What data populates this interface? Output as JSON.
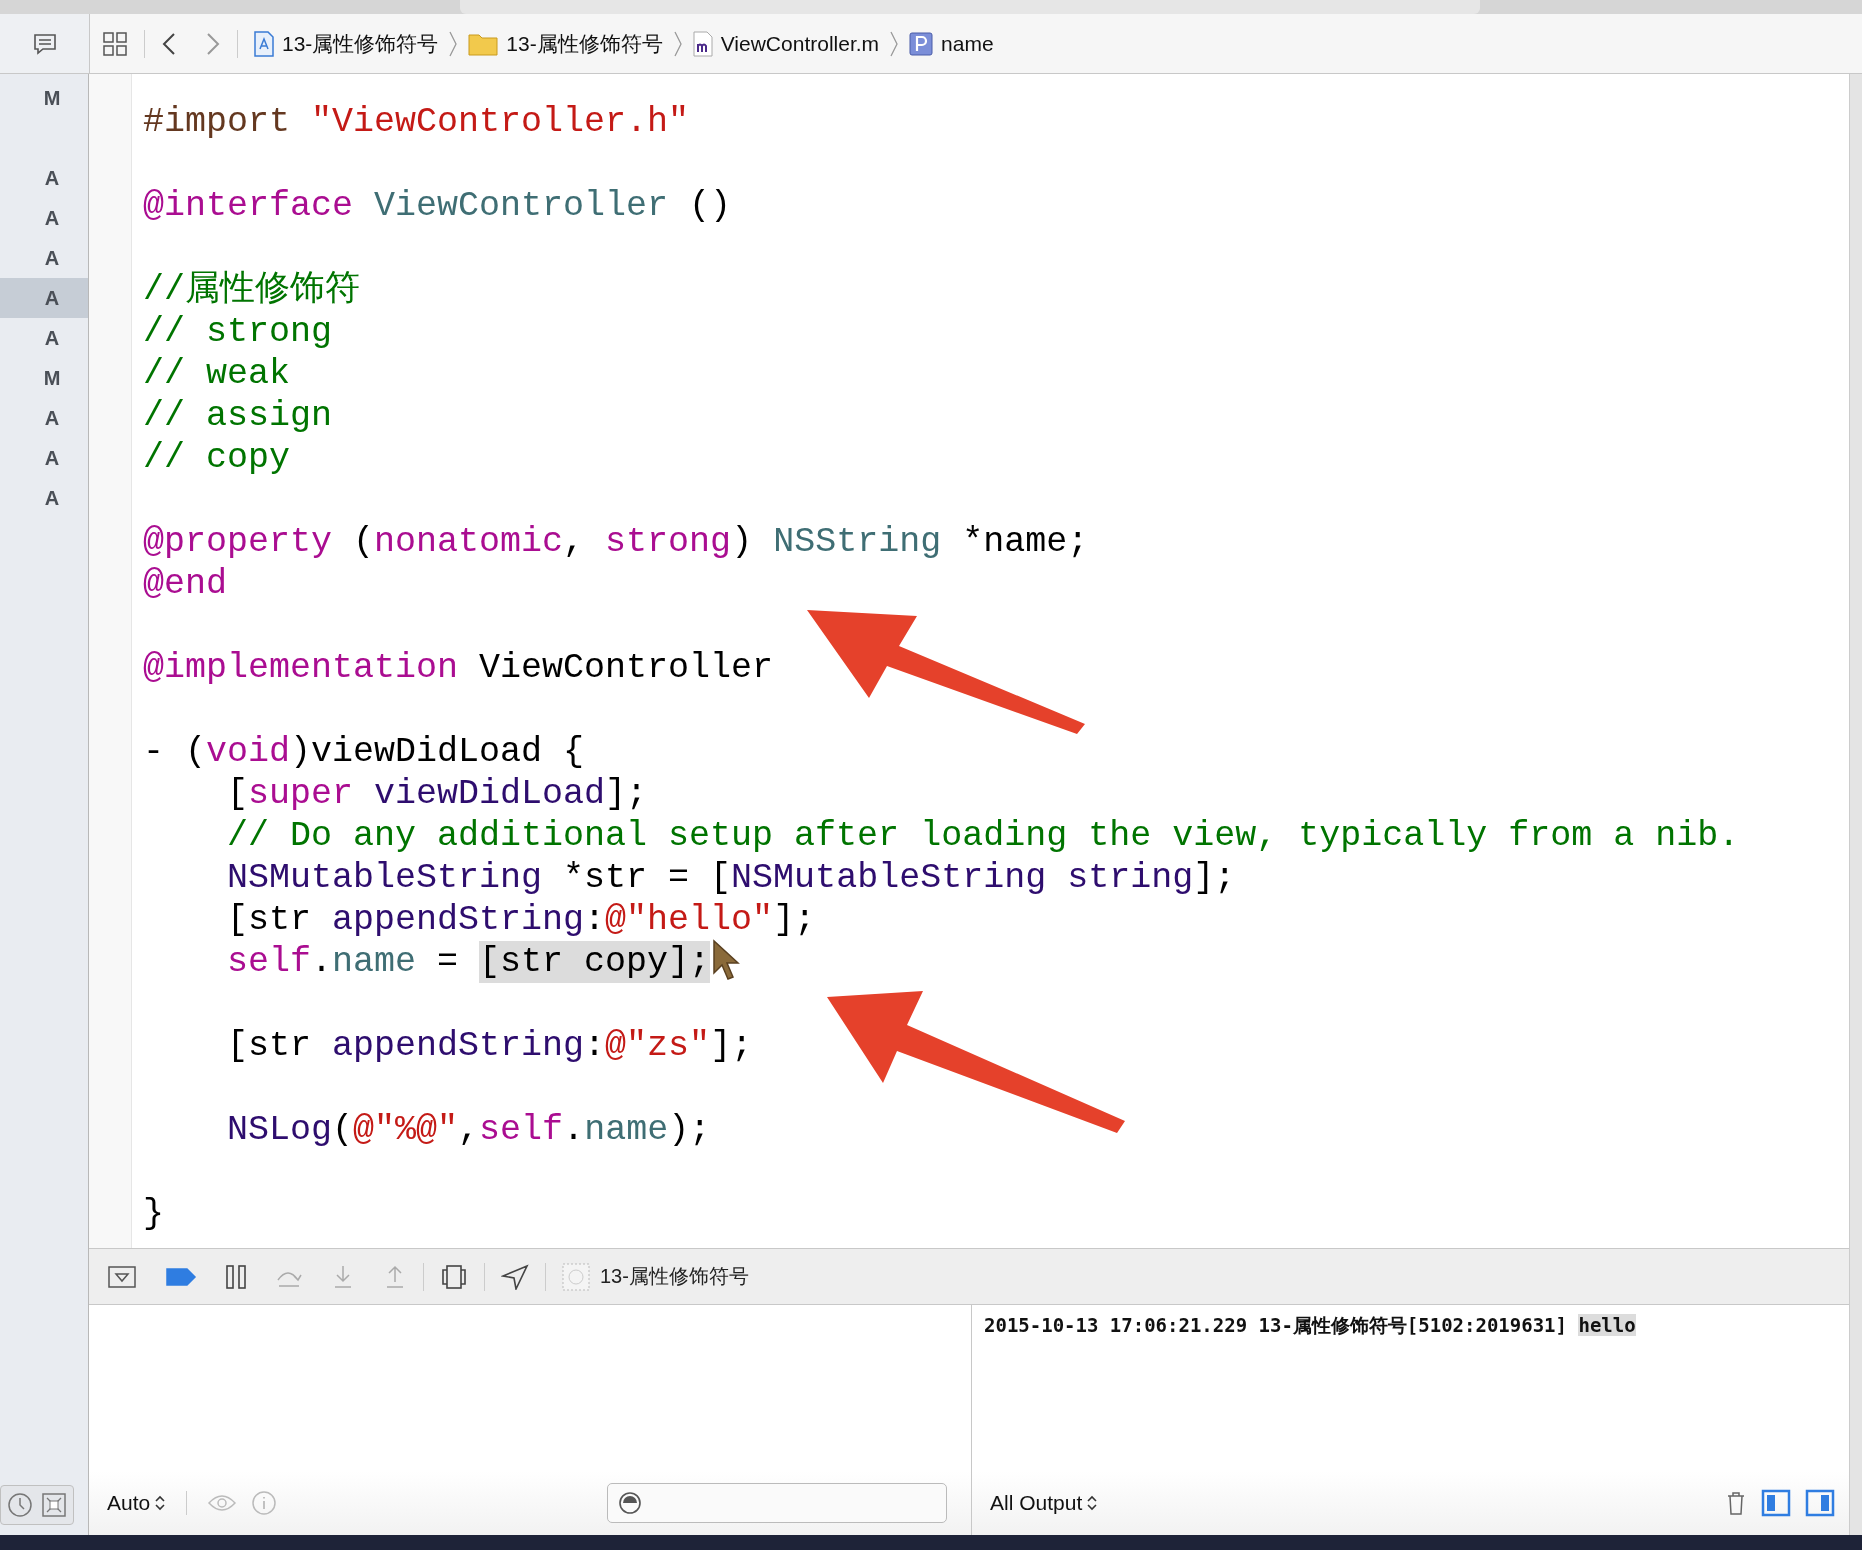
{
  "breadcrumb": [
    {
      "kind": "project",
      "label": "13-属性修饰符号"
    },
    {
      "kind": "folder",
      "label": "13-属性修饰符号"
    },
    {
      "kind": "mfile",
      "label": "ViewController.m"
    },
    {
      "kind": "property",
      "label": "name"
    }
  ],
  "status_letters": [
    {
      "letter": "M",
      "selected": false,
      "space_before": false
    },
    {
      "letter": "A",
      "selected": false,
      "space_before": true
    },
    {
      "letter": "A",
      "selected": false,
      "space_before": false
    },
    {
      "letter": "A",
      "selected": false,
      "space_before": false
    },
    {
      "letter": "A",
      "selected": true,
      "space_before": false
    },
    {
      "letter": "A",
      "selected": false,
      "space_before": false
    },
    {
      "letter": "M",
      "selected": false,
      "space_before": false
    },
    {
      "letter": "A",
      "selected": false,
      "space_before": false
    },
    {
      "letter": "A",
      "selected": false,
      "space_before": false
    },
    {
      "letter": "A",
      "selected": false,
      "space_before": false
    }
  ],
  "code_lines": [
    {
      "space_before": false,
      "tokens": [
        {
          "kind": "preproc",
          "text": "#import "
        },
        {
          "kind": "string",
          "text": "\"ViewController.h\""
        }
      ]
    },
    {
      "space_before": true,
      "tokens": [
        {
          "kind": "keyword",
          "text": "@interface"
        },
        {
          "kind": "class",
          "text": " ViewController"
        },
        {
          "kind": "plain",
          "text": " ()"
        }
      ]
    },
    {
      "space_before": true,
      "tokens": [
        {
          "kind": "comment",
          "text": "//属性修饰符"
        }
      ]
    },
    {
      "space_before": false,
      "tokens": [
        {
          "kind": "comment",
          "text": "// strong"
        }
      ]
    },
    {
      "space_before": false,
      "tokens": [
        {
          "kind": "comment",
          "text": "// weak"
        }
      ]
    },
    {
      "space_before": false,
      "tokens": [
        {
          "kind": "comment",
          "text": "// assign"
        }
      ]
    },
    {
      "space_before": false,
      "tokens": [
        {
          "kind": "comment",
          "text": "// copy"
        }
      ]
    },
    {
      "space_before": true,
      "tokens": [
        {
          "kind": "keyword",
          "text": "@property"
        },
        {
          "kind": "plain",
          "text": " ("
        },
        {
          "kind": "keyword",
          "text": "nonatomic"
        },
        {
          "kind": "plain",
          "text": ", "
        },
        {
          "kind": "keyword",
          "text": "strong"
        },
        {
          "kind": "plain",
          "text": ") "
        },
        {
          "kind": "class",
          "text": "NSString"
        },
        {
          "kind": "plain",
          "text": " *name;"
        }
      ]
    },
    {
      "space_before": false,
      "tokens": [
        {
          "kind": "keyword",
          "text": "@end"
        }
      ]
    },
    {
      "space_before": true,
      "tokens": [
        {
          "kind": "keyword",
          "text": "@implementation"
        },
        {
          "kind": "plain",
          "text": " ViewController"
        }
      ]
    },
    {
      "space_before": true,
      "tokens": [
        {
          "kind": "plain",
          "text": "- ("
        },
        {
          "kind": "keyword",
          "text": "void"
        },
        {
          "kind": "plain",
          "text": ")viewDidLoad {"
        }
      ]
    },
    {
      "space_before": false,
      "tokens": [
        {
          "kind": "plain",
          "text": "    ["
        },
        {
          "kind": "keyword",
          "text": "super"
        },
        {
          "kind": "method",
          "text": " viewDidLoad"
        },
        {
          "kind": "plain",
          "text": "];"
        }
      ]
    },
    {
      "space_before": false,
      "tokens": [
        {
          "kind": "comment",
          "text": "    // Do any additional setup after loading the view, typically from a nib."
        }
      ]
    },
    {
      "space_before": false,
      "tokens": [
        {
          "kind": "method",
          "text": "    NSMutableString"
        },
        {
          "kind": "plain",
          "text": " *str = ["
        },
        {
          "kind": "method",
          "text": "NSMutableString"
        },
        {
          "kind": "method",
          "text": " string"
        },
        {
          "kind": "plain",
          "text": "];"
        }
      ]
    },
    {
      "space_before": false,
      "tokens": [
        {
          "kind": "plain",
          "text": "    [str "
        },
        {
          "kind": "method",
          "text": "appendString"
        },
        {
          "kind": "plain",
          "text": ":"
        },
        {
          "kind": "string",
          "text": "@\"hello\""
        },
        {
          "kind": "plain",
          "text": "];"
        }
      ]
    },
    {
      "space_before": false,
      "tokens": [
        {
          "kind": "keyword",
          "text": "    self"
        },
        {
          "kind": "plain",
          "text": "."
        },
        {
          "kind": "property",
          "text": "name"
        },
        {
          "kind": "plain",
          "text": " = "
        },
        {
          "kind": "selection",
          "text": "[str copy];"
        }
      ]
    },
    {
      "space_before": true,
      "tokens": [
        {
          "kind": "plain",
          "text": "    [str "
        },
        {
          "kind": "method",
          "text": "appendString"
        },
        {
          "kind": "plain",
          "text": ":"
        },
        {
          "kind": "string",
          "text": "@\"zs\""
        },
        {
          "kind": "plain",
          "text": "];"
        }
      ]
    },
    {
      "space_before": true,
      "tokens": [
        {
          "kind": "method",
          "text": "    NSLog"
        },
        {
          "kind": "plain",
          "text": "("
        },
        {
          "kind": "string",
          "text": "@\"%@\""
        },
        {
          "kind": "plain",
          "text": ","
        },
        {
          "kind": "keyword",
          "text": "self"
        },
        {
          "kind": "plain",
          "text": "."
        },
        {
          "kind": "property",
          "text": "name"
        },
        {
          "kind": "plain",
          "text": ");"
        }
      ]
    },
    {
      "space_before": true,
      "tokens": [
        {
          "kind": "plain",
          "text": "}"
        }
      ]
    }
  ],
  "debug_bar": {
    "breakpoints_active": true,
    "process": "13-属性修饰符号"
  },
  "console": {
    "log": [
      {
        "text": "2015-10-13 17:06:21.229 13-属性修饰符号[5102:2019631] ",
        "highlighted": false
      },
      {
        "text": "hello",
        "highlighted": true
      }
    ]
  },
  "variables_bar": {
    "scope": "Auto"
  },
  "console_bar": {
    "output": "All Output"
  }
}
